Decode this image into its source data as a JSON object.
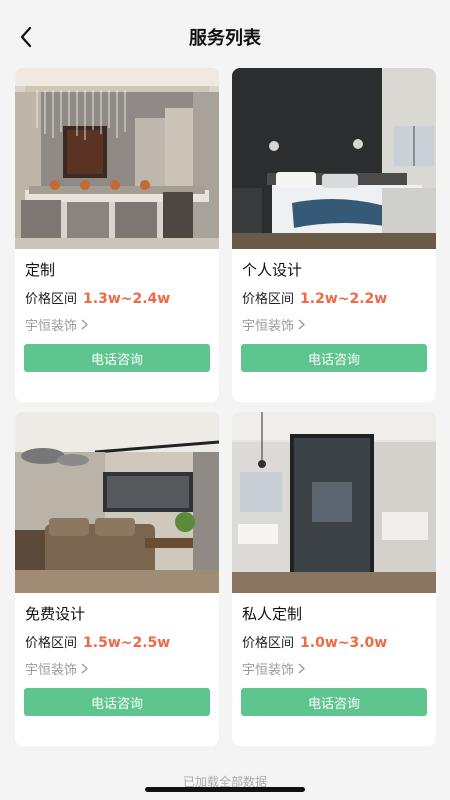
{
  "header": {
    "title": "服务列表",
    "back_icon": "chevron-left-icon"
  },
  "colors": {
    "accent_green": "#5fc58e",
    "price_orange": "#ee6a45"
  },
  "services": [
    {
      "name": "定制",
      "price_label": "价格区间",
      "price": "1.3w~2.4w",
      "company": "宇恒装饰",
      "button": "电话咨询"
    },
    {
      "name": "个人设计",
      "price_label": "价格区间",
      "price": "1.2w~2.2w",
      "company": "宇恒装饰",
      "button": "电话咨询"
    },
    {
      "name": "免费设计",
      "price_label": "价格区间",
      "price": "1.5w~2.5w",
      "company": "宇恒装饰",
      "button": "电话咨询"
    },
    {
      "name": "私人定制",
      "price_label": "价格区间",
      "price": "1.0w~3.0w",
      "company": "宇恒装饰",
      "button": "电话咨询"
    }
  ],
  "footer": {
    "text": "已加载全部数据"
  }
}
